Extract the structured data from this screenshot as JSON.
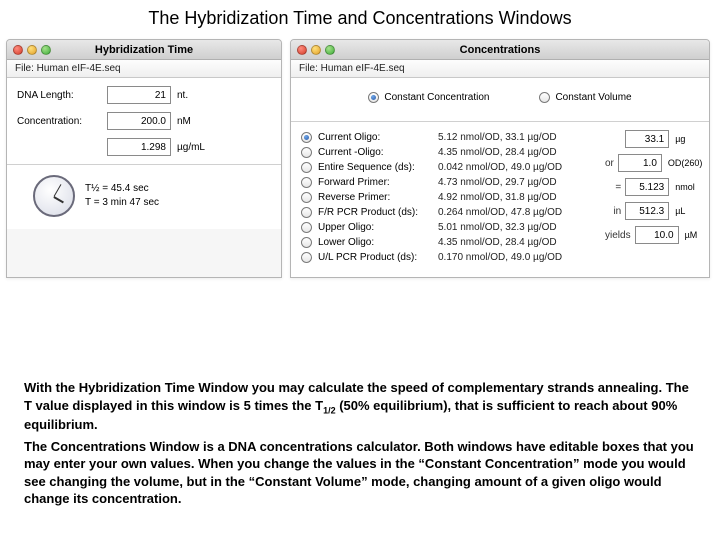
{
  "page_title": "The Hybridization Time and Concentrations Windows",
  "hyb": {
    "title": "Hybridization Time",
    "file_label": "File: Human eIF-4E.seq",
    "dna_length_label": "DNA Length:",
    "dna_length_value": "21",
    "dna_length_unit": "nt.",
    "concentration_label": "Concentration:",
    "concentration_value": "200.0",
    "concentration_unit": "nM",
    "density_value": "1.298",
    "density_unit": "µg/mL",
    "t_half": "T½ = 45.4 sec",
    "t_full": "T   = 3 min 47 sec"
  },
  "conc": {
    "title": "Concentrations",
    "file_label": "File: Human eIF-4E.seq",
    "mode_constant_conc": "Constant Concentration",
    "mode_constant_vol": "Constant Volume",
    "items": [
      {
        "name": "Current Oligo:",
        "val": "5.12 nmol/OD, 33.1 µg/OD"
      },
      {
        "name": "Current -Oligo:",
        "val": "4.35 nmol/OD, 28.4 µg/OD"
      },
      {
        "name": "Entire Sequence (ds):",
        "val": "0.042 nmol/OD, 49.0 µg/OD"
      },
      {
        "name": "Forward Primer:",
        "val": "4.73 nmol/OD, 29.7 µg/OD"
      },
      {
        "name": "Reverse Primer:",
        "val": "4.92 nmol/OD, 31.8 µg/OD"
      },
      {
        "name": "F/R PCR Product (ds):",
        "val": "0.264 nmol/OD, 47.8 µg/OD"
      },
      {
        "name": "Upper Oligo:",
        "val": "5.01 nmol/OD, 32.3 µg/OD"
      },
      {
        "name": "Lower Oligo:",
        "val": "4.35 nmol/OD, 28.4 µg/OD"
      },
      {
        "name": "U/L PCR Product (ds):",
        "val": "0.170 nmol/OD, 49.0 µg/OD"
      }
    ],
    "side": {
      "mass": {
        "pre": "",
        "value": "33.1",
        "unit": "µg"
      },
      "od": {
        "pre": "or",
        "value": "1.0",
        "unit": "OD(260)"
      },
      "nmol": {
        "pre": "=",
        "value": "5.123",
        "unit": "nmol"
      },
      "vol": {
        "pre": "in",
        "value": "512.3",
        "unit": "µL"
      },
      "yield": {
        "pre": "yields",
        "value": "10.0",
        "unit": "µM"
      }
    }
  },
  "footer": {
    "p1a": "With the Hybridization Time Window you may calculate the speed of complementary strands annealing. The T value displayed in this window is 5 times the T",
    "p1b": " (50% equilibrium), that is sufficient to reach about 90% equilibrium.",
    "p2": "The Concentrations Window is a DNA concentrations calculator. Both windows have editable boxes that you may enter your own values. When you change the values in the “Constant Concentration” mode you would see changing the volume, but in the “Constant Volume” mode, changing amount of a given oligo would change its concentration."
  }
}
